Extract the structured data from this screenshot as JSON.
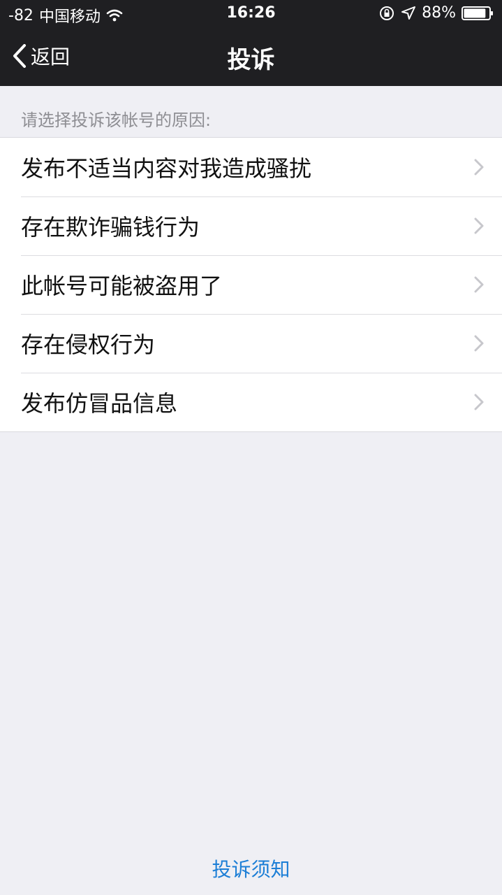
{
  "status_bar": {
    "signal": "-82",
    "carrier": "中国移动",
    "time": "16:26",
    "battery_percent": "88%",
    "battery_level": 0.88,
    "icons": [
      "wifi-icon",
      "orientation-lock-icon",
      "location-icon",
      "battery-icon"
    ]
  },
  "navbar": {
    "back_label": "返回",
    "title": "投诉"
  },
  "prompt": "请选择投诉该帐号的原因:",
  "reasons": [
    {
      "label": "发布不适当内容对我造成骚扰"
    },
    {
      "label": "存在欺诈骗钱行为"
    },
    {
      "label": "此帐号可能被盗用了"
    },
    {
      "label": "存在侵权行为"
    },
    {
      "label": "发布仿冒品信息"
    }
  ],
  "footer": {
    "link_label": "投诉须知"
  },
  "colors": {
    "nav_background": "#1f1f22",
    "page_background": "#efeff4",
    "link_blue": "#1c7ed6"
  }
}
